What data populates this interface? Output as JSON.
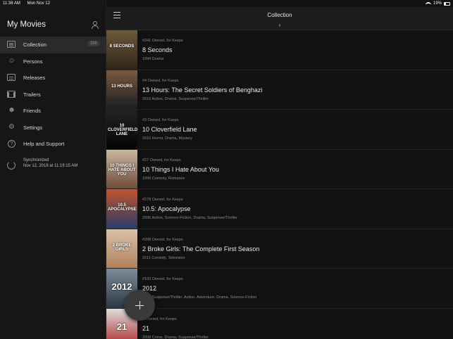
{
  "status": {
    "time": "11:38 AM",
    "date": "Mon Nov 12",
    "battery": "19%"
  },
  "sidebar": {
    "title": "My Movies",
    "items": [
      {
        "label": "Collection",
        "badge": "388",
        "icon": "collection-icon"
      },
      {
        "label": "Persons",
        "icon": "persons-icon"
      },
      {
        "label": "Releases",
        "icon": "releases-icon"
      },
      {
        "label": "Trailers",
        "icon": "trailers-icon"
      },
      {
        "label": "Friends",
        "icon": "friends-icon"
      },
      {
        "label": "Settings",
        "icon": "gear-icon"
      },
      {
        "label": "Help and Support",
        "icon": "help-icon"
      }
    ],
    "sync": {
      "label": "Synchronized",
      "time": "Nov 12, 2018 at 11:19:15 AM"
    }
  },
  "header": {
    "title": "Collection",
    "section_index": "#"
  },
  "movies": [
    {
      "meta": "#241 Owned, for Keeps",
      "title": "8 Seconds",
      "genre": "1994 Drama",
      "poster_text": "8 SECONDS",
      "poster_colors": [
        "#6b5a3a",
        "#2f2418"
      ]
    },
    {
      "meta": "#4 Owned, for Keeps",
      "title": "13 Hours: The Secret Soldiers of Benghazi",
      "genre": "2016 Action, Drama, Suspense/Thriller",
      "poster_text": "13 HOURS",
      "poster_colors": [
        "#7a5a3e",
        "#1c1c22"
      ]
    },
    {
      "meta": "#3 Owned, for Keeps",
      "title": "10 Cloverfield Lane",
      "genre": "2016 Horror, Drama, Mystery",
      "poster_text": "10 CLOVERFIELD LANE",
      "poster_colors": [
        "#222",
        "#050505"
      ]
    },
    {
      "meta": "#27 Owned, for Keeps",
      "title": "10 Things I Hate About You",
      "genre": "1999 Comedy, Romance",
      "poster_text": "10 THINGS I HATE ABOUT YOU",
      "poster_colors": [
        "#c9b8a0",
        "#6e4b3a"
      ]
    },
    {
      "meta": "#278 Owned, for Keeps",
      "title": "10.5: Apocalypse",
      "genre": "2006 Action, Science-Fiction, Drama, Suspense/Thriller",
      "poster_text": "10.5 APOCALYPSE",
      "poster_colors": [
        "#c0542a",
        "#2a3c66"
      ]
    },
    {
      "meta": "#268 Owned, for Keeps",
      "title": "2 Broke Girls: The Complete First Season",
      "genre": "2011 Comedy, Television",
      "poster_text": "2 BROKE GIRLS",
      "poster_colors": [
        "#d8c2a8",
        "#b1805c"
      ]
    },
    {
      "meta": "#103 Owned, for Keeps",
      "title": "2012",
      "genre": "2009 Suspense/Thriller, Action, Adventure, Drama, Science-Fiction",
      "poster_text": "2012",
      "poster_colors": [
        "#7f8c99",
        "#2c3744"
      ]
    },
    {
      "meta": "# Owned, for Keeps",
      "title": "21",
      "genre": "2008 Crime, Drama, Suspense/Thriller",
      "poster_text": "21",
      "poster_colors": [
        "#ddd",
        "#a22"
      ]
    }
  ]
}
